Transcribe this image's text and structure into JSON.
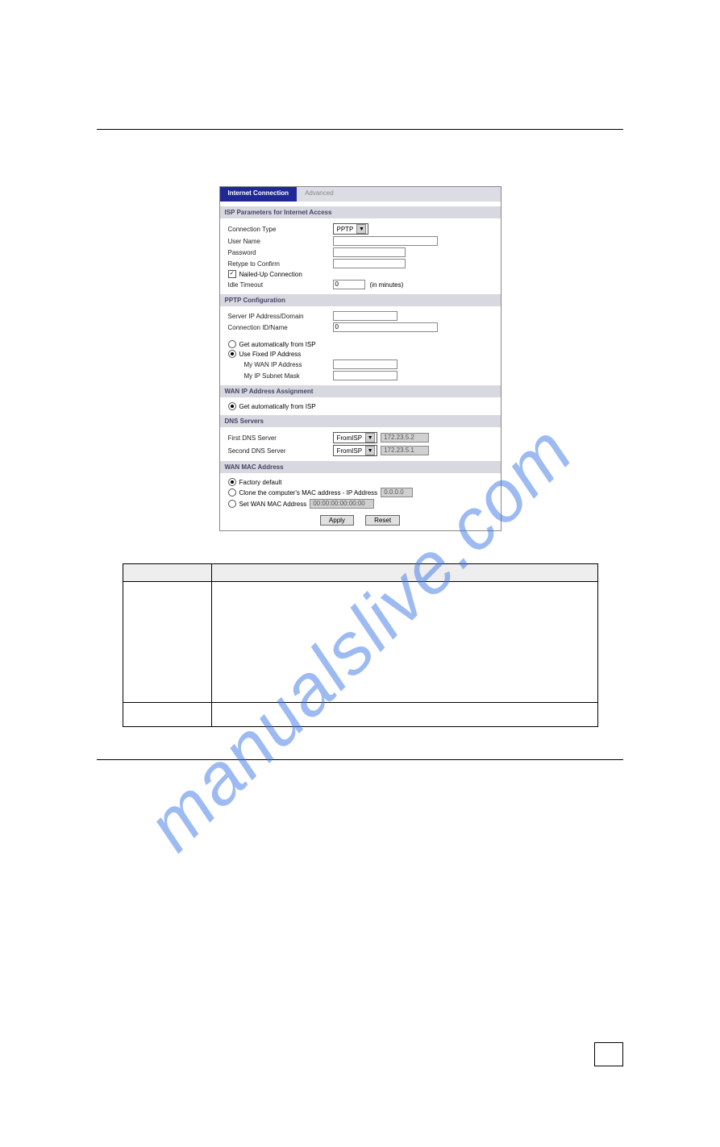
{
  "watermark": "manualslive.com",
  "screenshot": {
    "tabs": {
      "active": "Internet Connection",
      "inactive": "Advanced"
    },
    "section_isp": "ISP Parameters for Internet Access",
    "conn_type_label": "Connection Type",
    "conn_type_value": "PPTP",
    "user_name_label": "User Name",
    "password_label": "Password",
    "retype_label": "Retype to Confirm",
    "nailed_up_label": "Nailed-Up Connection",
    "idle_timeout_label": "Idle Timeout",
    "idle_timeout_value": "0",
    "idle_timeout_suffix": "(in minutes)",
    "section_pptp": "PPTP Configuration",
    "server_ip_label": "Server IP Address/Domain",
    "conn_id_label": "Connection ID/Name",
    "conn_id_value": "0",
    "get_auto_isp": "Get automatically from ISP",
    "fixed_ip_label": "Use Fixed IP Address",
    "my_wan_ip": "My WAN IP Address",
    "my_subnet": "My IP Subnet Mask",
    "section_wan_assign": "WAN IP Address Assignment",
    "wan_get_auto": "Get automatically from ISP",
    "section_dns": "DNS Servers",
    "first_dns_label": "First DNS Server",
    "second_dns_label": "Second DNS Server",
    "dns_from_isp": "FromISP",
    "dns_val1": "172.23.5.2",
    "dns_val2": "172.23.5.1",
    "section_mac": "WAN MAC Address",
    "factory_default": "Factory default",
    "clone_label": "Clone the computer's MAC address - IP Address",
    "clone_value": "0.0.0.0",
    "set_mac_label": "Set WAN MAC Address",
    "set_mac_value": "00:00:00:00:00:00",
    "apply_btn": "Apply",
    "reset_btn": "Reset"
  },
  "table": {
    "col1_header": "",
    "col2_header": "",
    "row1_col1": "",
    "row1_col2": "",
    "row2_col1": "",
    "row2_col2": ""
  }
}
